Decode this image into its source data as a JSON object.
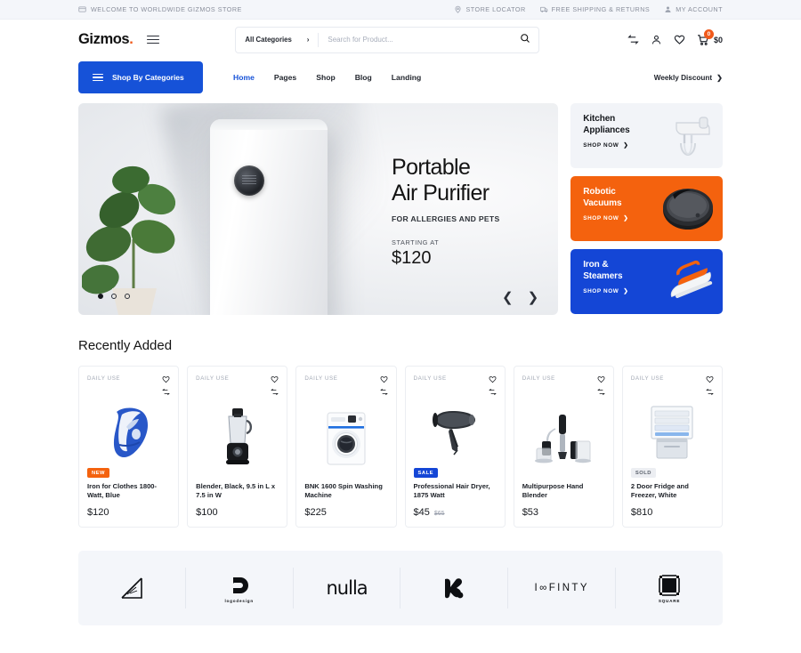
{
  "topbar": {
    "welcome": "WELCOME TO WORLDWIDE GIZMOS STORE",
    "welcome_icon": "card-icon",
    "links": [
      {
        "label": "STORE LOCATOR",
        "icon": "location-pin-icon"
      },
      {
        "label": "FREE SHIPPING & RETURNS",
        "icon": "delivery-truck-icon"
      },
      {
        "label": "MY ACCOUNT",
        "icon": "user-icon"
      }
    ]
  },
  "header": {
    "logo": "Gizmos",
    "logo_dot": ".",
    "menu_icon": "hamburger-icon",
    "search": {
      "category_label": "All Categories",
      "category_chevron": "chevron-right-icon",
      "placeholder": "Search for Product...",
      "value": "",
      "search_icon": "search-icon"
    },
    "icons": [
      {
        "name": "compare-icon"
      },
      {
        "name": "account-icon"
      },
      {
        "name": "wishlist-heart-icon"
      }
    ],
    "cart": {
      "icon": "shopping-cart-icon",
      "count": "0",
      "total": "$0"
    }
  },
  "nav": {
    "shop_by_categories": "Shop By Categories",
    "categories_icon": "hamburger-icon",
    "links": [
      {
        "label": "Home",
        "active": true
      },
      {
        "label": "Pages",
        "active": false
      },
      {
        "label": "Shop",
        "active": false
      },
      {
        "label": "Blog",
        "active": false
      },
      {
        "label": "Landing",
        "active": false
      }
    ],
    "weekly_discount": "Weekly Discount",
    "weekly_chevron": "chevron-right-icon"
  },
  "hero": {
    "title_line1": "Portable",
    "title_line2": "Air Purifier",
    "subtitle": "FOR ALLERGIES AND PETS",
    "starting_label": "STARTING AT",
    "price": "$120",
    "dots": [
      {
        "active": true
      },
      {
        "active": false
      },
      {
        "active": false
      }
    ],
    "prev_icon": "chevron-left-icon",
    "next_icon": "chevron-right-icon"
  },
  "side_cards": [
    {
      "title_line1": "Kitchen",
      "title_line2": "Appliances",
      "cta": "SHOP NOW",
      "cta_icon": "chevron-right-icon",
      "style": "gray",
      "art": "hand-mixer-icon",
      "bg": "#f2f4f8"
    },
    {
      "title_line1": "Robotic",
      "title_line2": "Vacuums",
      "cta": "SHOP NOW",
      "cta_icon": "chevron-right-icon",
      "style": "orange",
      "art": "robot-vacuum-icon",
      "bg": "#f4620e"
    },
    {
      "title_line1": "Iron &",
      "title_line2": "Steamers",
      "cta": "SHOP NOW",
      "cta_icon": "chevron-right-icon",
      "style": "blue",
      "art": "clothes-iron-icon",
      "bg": "#1446d6"
    }
  ],
  "recently_added": {
    "title": "Recently Added",
    "products": [
      {
        "tag": "DAILY USE",
        "badge": "NEW",
        "badge_style": "new",
        "name": "Iron for Clothes 1800-Watt, Blue",
        "price": "$120",
        "old_price": "",
        "image": "blue-clothes-iron-image"
      },
      {
        "tag": "DAILY USE",
        "badge": "",
        "badge_style": "",
        "name": "Blender, Black, 9.5 in L x 7.5 in W",
        "price": "$100",
        "old_price": "",
        "image": "black-blender-image"
      },
      {
        "tag": "DAILY USE",
        "badge": "",
        "badge_style": "",
        "name": "BNK 1600 Spin Washing Machine",
        "price": "$225",
        "old_price": "",
        "image": "washing-machine-image"
      },
      {
        "tag": "DAILY USE",
        "badge": "SALE",
        "badge_style": "sale",
        "name": "Professional Hair Dryer, 1875 Watt",
        "price": "$45",
        "old_price": "$65",
        "image": "hair-dryer-image"
      },
      {
        "tag": "DAILY USE",
        "badge": "",
        "badge_style": "",
        "name": "Multipurpose Hand Blender",
        "price": "$53",
        "old_price": "",
        "image": "hand-blender-image"
      },
      {
        "tag": "DAILY USE",
        "badge": "SOLD",
        "badge_style": "sold",
        "name": "2 Door Fridge and Freezer, White",
        "price": "$810",
        "old_price": "",
        "image": "fridge-freezer-image"
      }
    ],
    "wishlist_icon": "heart-icon",
    "compare_icon": "compare-arrows-icon"
  },
  "brands": [
    {
      "name": "",
      "sub": "",
      "kind": "diagonal-lines-logo"
    },
    {
      "name": "",
      "sub": "logodesign",
      "kind": "logodesign-logo"
    },
    {
      "name": "nulla",
      "sub": "",
      "kind": "nulla-wordmark-logo"
    },
    {
      "name": "",
      "sub": "",
      "kind": "blob-mark-logo"
    },
    {
      "name": "I∞FINTY",
      "sub": "",
      "kind": "infinty-wordmark-logo"
    },
    {
      "name": "",
      "sub": "SQUARE",
      "kind": "square-logo"
    }
  ],
  "colors": {
    "brand_blue": "#1652d8",
    "brand_orange": "#f4620e",
    "card_blue": "#1446d6",
    "light_bg": "#f4f6fa",
    "text_dark": "#15181d",
    "muted": "#9aa0ad"
  }
}
